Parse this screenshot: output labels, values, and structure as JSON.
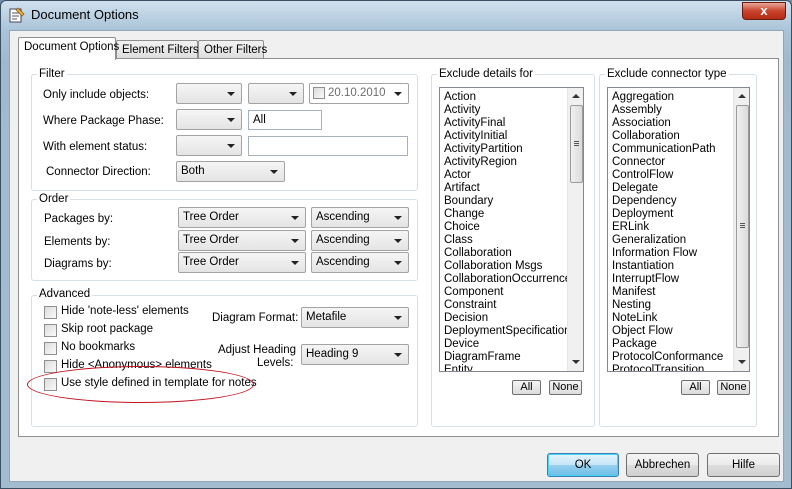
{
  "window": {
    "title": "Document Options",
    "close_label": "x"
  },
  "tabs": [
    {
      "label": "Document Options"
    },
    {
      "label": "Element Filters"
    },
    {
      "label": "Other Filters"
    }
  ],
  "filter": {
    "title": "Filter",
    "only_include_label": "Only include objects:",
    "combo1_value": "",
    "combo2_value": "",
    "date_value": "20.10.2010",
    "package_phase_label": "Where Package Phase:",
    "package_phase_combo": "",
    "package_phase_value": "All",
    "element_status_label": "With element status:",
    "element_status_combo": "",
    "element_status_value": "",
    "connector_direction_label": "Connector Direction:",
    "connector_direction_value": "Both"
  },
  "order": {
    "title": "Order",
    "packages_label": "Packages by:",
    "packages_order": "Tree Order",
    "packages_dir": "Ascending",
    "elements_label": "Elements by:",
    "elements_order": "Tree Order",
    "elements_dir": "Ascending",
    "diagrams_label": "Diagrams by:",
    "diagrams_order": "Tree Order",
    "diagrams_dir": "Ascending"
  },
  "advanced": {
    "title": "Advanced",
    "checkboxes": [
      {
        "label": "Hide 'note-less' elements",
        "checked": false
      },
      {
        "label": "Skip root package",
        "checked": false
      },
      {
        "label": "No bookmarks",
        "checked": false
      },
      {
        "label": "Hide <Anonymous> elements",
        "checked": false
      },
      {
        "label": "Use style defined in template for notes",
        "checked": false
      }
    ],
    "diagram_format_label": "Diagram Format:",
    "diagram_format_value": "Metafile",
    "heading_label_line1": "Adjust Heading",
    "heading_label_line2": "Levels:",
    "heading_value": "Heading 9"
  },
  "exclude_details": {
    "title": "Exclude details for",
    "items": [
      "Action",
      "Activity",
      "ActivityFinal",
      "ActivityInitial",
      "ActivityPartition",
      "ActivityRegion",
      "Actor",
      "Artifact",
      "Boundary",
      "Change",
      "Choice",
      "Class",
      "Collaboration",
      "Collaboration Msgs",
      "CollaborationOccurrence",
      "Component",
      "Constraint",
      "Decision",
      "DeploymentSpecification",
      "Device",
      "DiagramFrame",
      "Entity"
    ],
    "all_label": "All",
    "none_label": "None"
  },
  "exclude_connector": {
    "title": "Exclude connector type",
    "items": [
      "Aggregation",
      "Assembly",
      "Association",
      "Collaboration",
      "CommunicationPath",
      "Connector",
      "ControlFlow",
      "Delegate",
      "Dependency",
      "Deployment",
      "ERLink",
      "Generalization",
      "Information Flow",
      "Instantiation",
      "InterruptFlow",
      "Manifest",
      "Nesting",
      "NoteLink",
      "Object Flow",
      "Package",
      "ProtocolConformance",
      "ProtocolTransition"
    ],
    "all_label": "All",
    "none_label": "None"
  },
  "buttons": {
    "ok": "OK",
    "cancel": "Abbrechen",
    "help": "Hilfe"
  },
  "colors": {
    "annotation": "#c1121f",
    "default_button": "#6cbce5"
  }
}
